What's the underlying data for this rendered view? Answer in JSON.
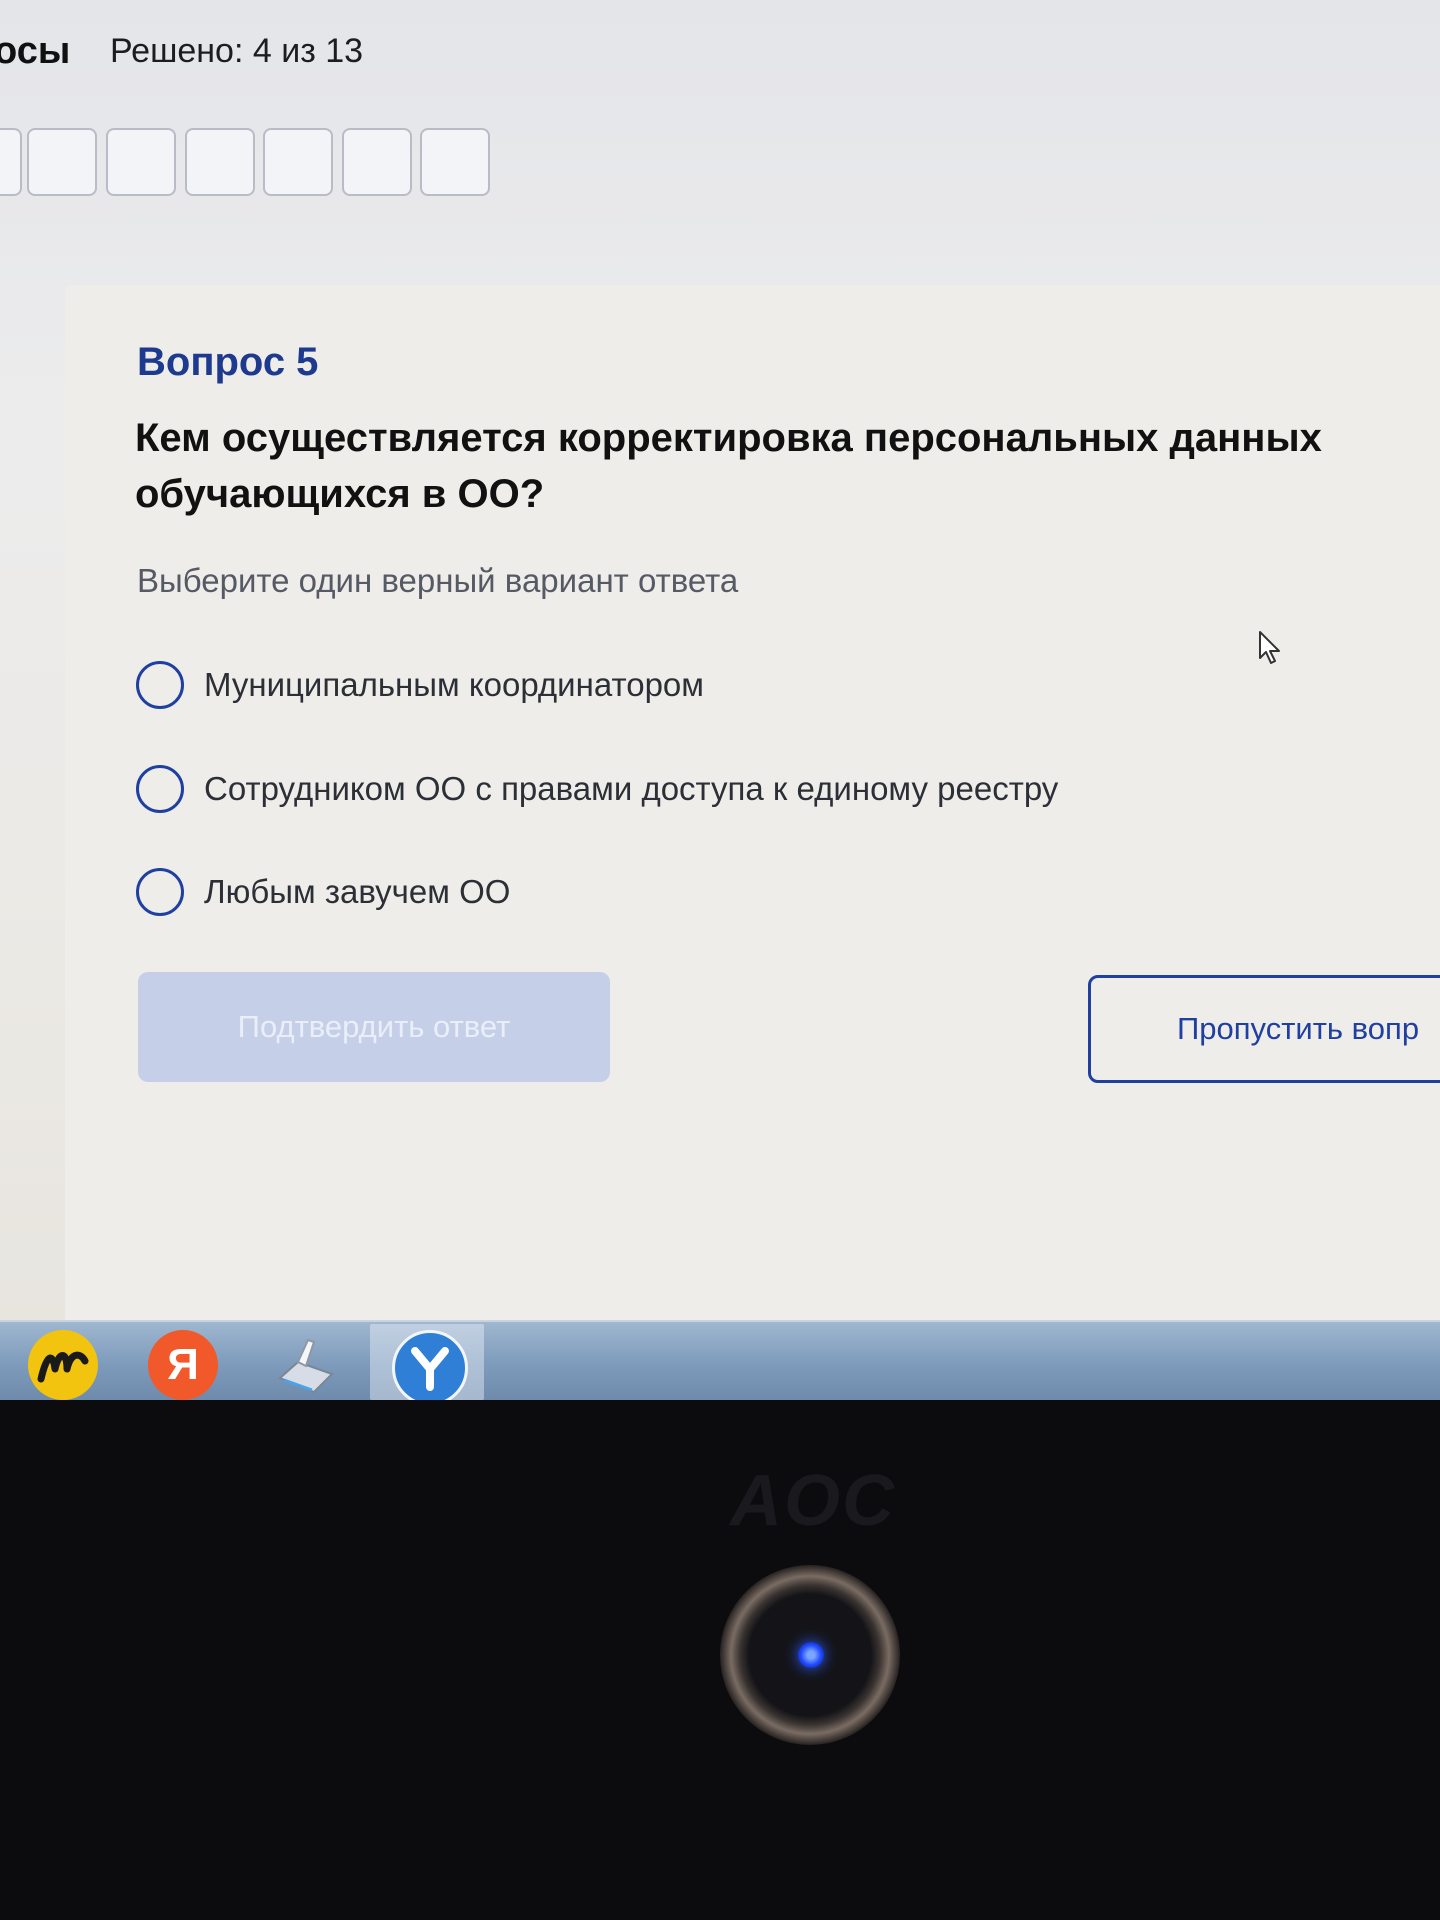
{
  "header": {
    "title_fragment": "осы",
    "progress": "Решено: 4 из 13"
  },
  "question": {
    "number_label": "Вопрос 5",
    "text": "Кем осуществляется корректировка персональных данных обучающихся в ОО?",
    "instruction": "Выберите один верный вариант ответа",
    "options": [
      {
        "label": "Муниципальным координатором",
        "selected": false
      },
      {
        "label": "Сотрудником ОО с правами доступа к единому реестру",
        "selected": false
      },
      {
        "label": "Любым завучем ОО",
        "selected": false
      }
    ]
  },
  "actions": {
    "confirm_label": "Подтвердить ответ",
    "confirm_enabled": false,
    "skip_label": "Пропустить вопр"
  },
  "taskbar": {
    "icons": [
      "yandex-market-icon",
      "yandex-icon",
      "scanner-icon",
      "yandex-browser-icon"
    ],
    "yandex_letter": "Я",
    "market_letter": "M"
  },
  "monitor": {
    "brand": "AOC"
  },
  "colors": {
    "accent": "#1f3fa1",
    "heading_blue": "#1e3a8f",
    "disabled_button": "#c5d0e8"
  }
}
